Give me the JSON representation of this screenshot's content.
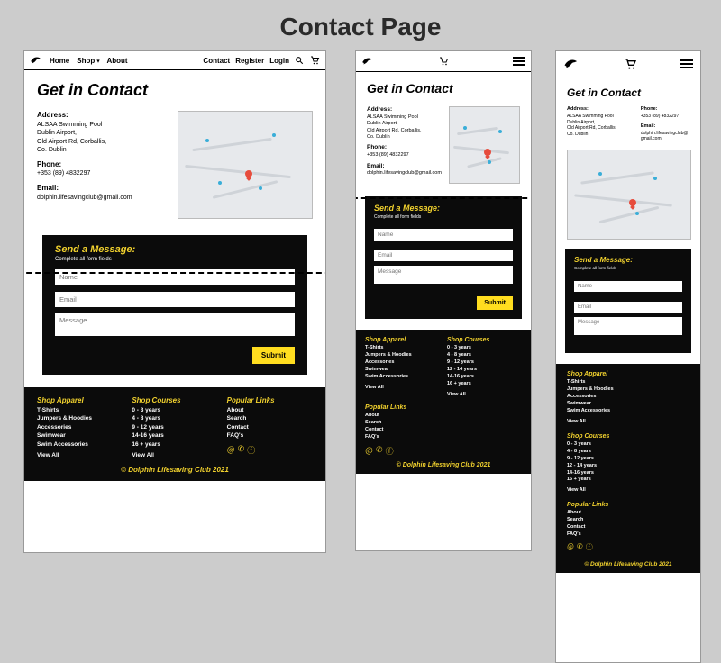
{
  "page_title": "Contact Page",
  "nav": {
    "home": "Home",
    "shop": "Shop",
    "about": "About",
    "contact": "Contact",
    "register": "Register",
    "login": "Login"
  },
  "heading": "Get in Contact",
  "address": {
    "label": "Address:",
    "line1": "ALSAA Swimming Pool",
    "line2": "Dublin Airport,",
    "line3": "Old Airport Rd, Corballis,",
    "line4": "Co. Dublin"
  },
  "phone": {
    "label": "Phone:",
    "value": "+353 (89) 4832297"
  },
  "email": {
    "label": "Email:",
    "value": "dolphin.lifesavingclub@gmail.com"
  },
  "form": {
    "title": "Send a Message:",
    "subtitle": "Complete all form fields",
    "name_ph": "Name",
    "email_ph": "Email",
    "message_ph": "Message",
    "submit": "Submit"
  },
  "footer": {
    "apparel": {
      "heading": "Shop Apparel",
      "items": [
        "T-Shirts",
        "Jumpers & Hoodies",
        "Accessories",
        "Swimwear",
        "Swim Accessories"
      ]
    },
    "courses": {
      "heading": "Shop Courses",
      "items": [
        "0 - 3 years",
        "4 - 8 years",
        "9 - 12 years",
        "12 - 14 years",
        "14-16 years",
        "16 + years"
      ]
    },
    "courses_short": {
      "heading": "Shop Courses",
      "items": [
        "0 - 3 years",
        "4 - 8 years",
        "9 - 12 years",
        "14-16 years",
        "16 + years"
      ]
    },
    "popular": {
      "heading": "Popular Links",
      "items": [
        "About",
        "Search",
        "Contact",
        "FAQ's"
      ]
    },
    "view_all": "View All",
    "copyright": "© Dolphin Lifesaving Club 2021"
  }
}
